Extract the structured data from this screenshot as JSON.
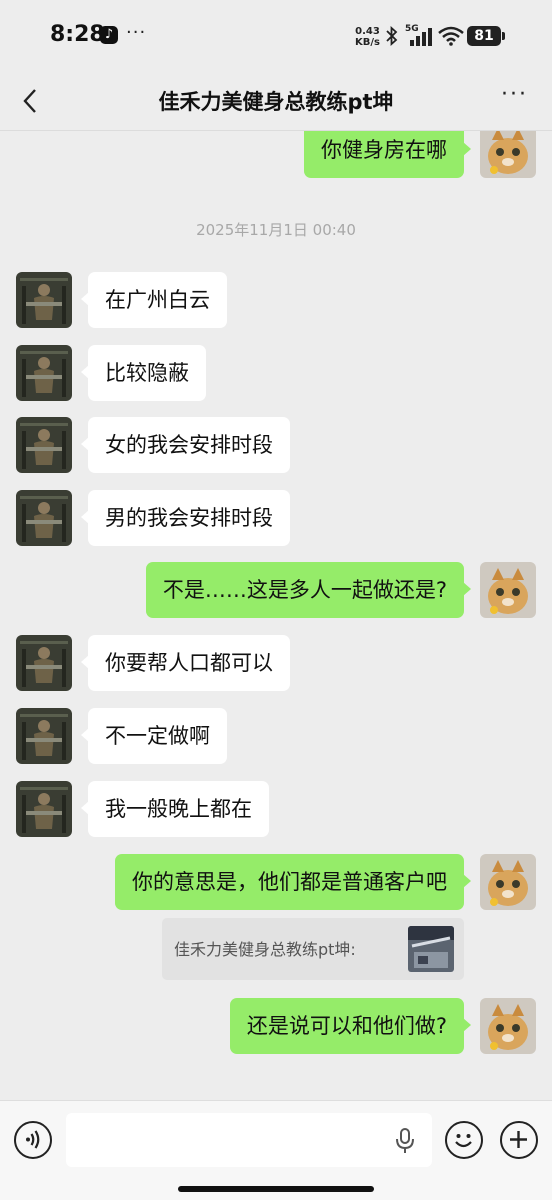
{
  "status_bar": {
    "time": "8:28",
    "app_icon": "tiktok-icon",
    "more": "···",
    "net_speed_value": "0.43",
    "net_speed_unit": "KB/s",
    "network_label": "5G",
    "battery": "81"
  },
  "header": {
    "title": "佳禾力美健身总教练pt坤",
    "back_icon": "chevron-left-icon",
    "more_icon": "more-dots-icon",
    "more": "···"
  },
  "chat": {
    "messages": [
      {
        "side": "right",
        "text": "你健身房在哪"
      },
      {
        "type": "timestamp",
        "text": "2025年11月1日 00:40"
      },
      {
        "side": "left",
        "text": "在广州白云"
      },
      {
        "side": "left",
        "text": "比较隐蔽"
      },
      {
        "side": "left",
        "text": "女的我会安排时段"
      },
      {
        "side": "left",
        "text": "男的我会安排时段"
      },
      {
        "side": "right",
        "text": "不是……这是多人一起做还是?"
      },
      {
        "side": "left",
        "text": "你要帮人口都可以"
      },
      {
        "side": "left",
        "text": "不一定做啊"
      },
      {
        "side": "left",
        "text": "我一般晚上都在"
      },
      {
        "side": "right",
        "text": "你的意思是，他们都是普通客户吧"
      },
      {
        "type": "quote",
        "text": "佳禾力美健身总教练pt坤:"
      },
      {
        "side": "right",
        "text": "还是说可以和他们做?"
      }
    ]
  },
  "input_bar": {
    "voice_icon": "voice-icon",
    "mic_icon": "mic-icon",
    "emoji_icon": "emoji-icon",
    "plus_icon": "plus-icon"
  },
  "colors": {
    "background": "#ededed",
    "sent_bubble": "#95ec69",
    "received_bubble": "#ffffff",
    "timestamp": "#a8a8a8"
  }
}
